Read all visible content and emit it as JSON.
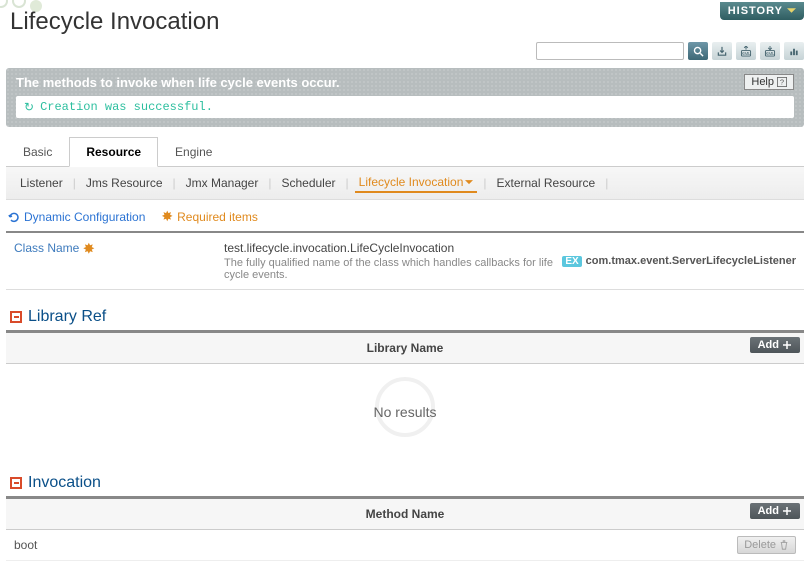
{
  "page": {
    "title": "Lifecycle Invocation",
    "history_label": "HISTORY"
  },
  "search": {
    "placeholder": ""
  },
  "banner": {
    "desc": "The methods to invoke when life cycle events occur.",
    "help_label": "Help",
    "message": "Creation was successful."
  },
  "tabs_main": {
    "items": [
      {
        "label": "Basic"
      },
      {
        "label": "Resource"
      },
      {
        "label": "Engine"
      }
    ],
    "active": 1
  },
  "tabs_sub": {
    "items": [
      {
        "label": "Listener"
      },
      {
        "label": "Jms Resource"
      },
      {
        "label": "Jmx Manager"
      },
      {
        "label": "Scheduler"
      },
      {
        "label": "Lifecycle Invocation"
      },
      {
        "label": "External Resource"
      }
    ],
    "active": 4
  },
  "legend": {
    "dynamic": "Dynamic Configuration",
    "required": "Required items"
  },
  "class_field": {
    "label": "Class Name",
    "value": "test.lifecycle.invocation.LifeCycleInvocation",
    "hint": "The fully qualified name of the class which handles callbacks for life cycle events.",
    "ex_badge": "EX",
    "example": "com.tmax.event.ServerLifecycleListener"
  },
  "library_section": {
    "title": "Library Ref",
    "col_header": "Library Name",
    "add_label": "Add",
    "empty": "No results"
  },
  "invocation_section": {
    "title": "Invocation",
    "col_header": "Method Name",
    "add_label": "Add",
    "rows": [
      {
        "method_name": "boot"
      }
    ],
    "delete_label": "Delete"
  }
}
